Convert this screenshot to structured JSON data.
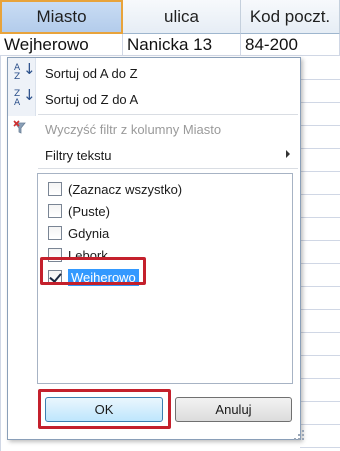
{
  "grid": {
    "columns": [
      "Miasto",
      "ulica",
      "Kod poczt."
    ],
    "row1": [
      "Wejherowo",
      "Nanicka 13",
      "84-200"
    ]
  },
  "menu": {
    "sort_asc": "Sortuj od A do Z",
    "sort_desc": "Sortuj od Z do A",
    "clear_filter": "Wyczyść filtr z kolumny Miasto",
    "text_filters": "Filtry tekstu"
  },
  "icons": {
    "sort_asc": "sort-az-icon",
    "sort_desc": "sort-za-icon",
    "clear_filter": "clear-filter-icon"
  },
  "filter_list": [
    {
      "label": "(Zaznacz wszystko)",
      "checked": false
    },
    {
      "label": "(Puste)",
      "checked": false
    },
    {
      "label": "Gdynia",
      "checked": false
    },
    {
      "label": "Lebork",
      "checked": false
    },
    {
      "label": "Wejherowo",
      "checked": true
    }
  ],
  "buttons": {
    "ok": "OK",
    "cancel": "Anuluj"
  },
  "colors": {
    "highlight": "#c4202c",
    "selection": "#3399ff",
    "active_header": "#e8a33b"
  }
}
